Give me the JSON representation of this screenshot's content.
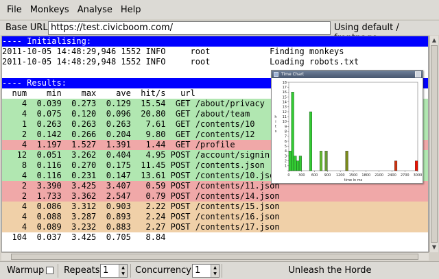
{
  "menu": {
    "items": [
      "File",
      "Monkeys",
      "Analyse",
      "Help"
    ]
  },
  "urlbar": {
    "label": "Base URL",
    "value": "https://test.civicboom.com/",
    "status": "Using default / frontpage"
  },
  "log": {
    "header_init": "---- Initialising:",
    "init_lines": [
      "2011-10-05 14:48:29,946 1552 INFO     root            Finding monkeys",
      "2011-10-05 14:48:29,948 1552 INFO     root            Loading robots.txt"
    ],
    "header_results": "---- Results:",
    "columns_line": "  num    min    max    ave  hit/s   url",
    "rows": [
      {
        "text": "    4  0.039  0.273  0.129  15.54  GET /about/privacy",
        "status": "ok"
      },
      {
        "text": "    4  0.075  0.120  0.096  20.80  GET /about/team",
        "status": "ok"
      },
      {
        "text": "    1  0.263  0.263  0.263   7.61  GET /contents/10",
        "status": "ok"
      },
      {
        "text": "    2  0.142  0.266  0.204   9.80  GET /contents/12",
        "status": "ok"
      },
      {
        "text": "    4  1.197  1.527  1.391   1.44  GET /profile",
        "status": "error"
      },
      {
        "text": "   12  0.051  3.262  0.404   4.95 POST /account/signin.json",
        "status": "ok"
      },
      {
        "text": "    8  0.116  0.270  0.175  11.45 POST /contents.json",
        "status": "ok"
      },
      {
        "text": "    4  0.116  0.231  0.147  13.61 POST /contents/10.json",
        "status": "ok"
      },
      {
        "text": "    2  3.390  3.425  3.407   0.59 POST /contents/11.json",
        "status": "error"
      },
      {
        "text": "    2  1.733  3.362  2.547   0.79 POST /contents/14.json",
        "status": "error"
      },
      {
        "text": "    4  0.086  3.312  0.903   2.22 POST /contents/15.json",
        "status": "warn"
      },
      {
        "text": "    4  0.088  3.287  0.893   2.24 POST /contents/16.json",
        "status": "warn"
      },
      {
        "text": "    4  0.089  3.232  0.883   2.27 POST /contents/17.json",
        "status": "warn"
      }
    ],
    "total_line": "  104  0.037  3.425  0.705   8.84"
  },
  "chart_window": {
    "title": "Time Chart"
  },
  "chart_data": {
    "type": "bar",
    "title": "",
    "xlabel": "time in ms",
    "ylabel": "hits",
    "xlim": [
      0,
      3000
    ],
    "ylim": [
      0,
      18
    ],
    "xticks": [
      0,
      300,
      600,
      900,
      1200,
      1500,
      1800,
      2100,
      2400,
      2700,
      3000
    ],
    "yticks": [
      0,
      1,
      2,
      3,
      4,
      5,
      6,
      7,
      8,
      9,
      10,
      11,
      12,
      13,
      14,
      15,
      16,
      17,
      18
    ],
    "bins": [
      {
        "x": 30,
        "value": 4,
        "color": "#33cc33"
      },
      {
        "x": 90,
        "value": 16,
        "color": "#33cc33"
      },
      {
        "x": 150,
        "value": 3,
        "color": "#33cc33"
      },
      {
        "x": 210,
        "value": 2,
        "color": "#33cc33"
      },
      {
        "x": 270,
        "value": 3,
        "color": "#33cc33"
      },
      {
        "x": 510,
        "value": 12,
        "color": "#33cc33"
      },
      {
        "x": 750,
        "value": 4,
        "color": "#66bb33"
      },
      {
        "x": 870,
        "value": 4,
        "color": "#669933"
      },
      {
        "x": 1350,
        "value": 4,
        "color": "#7a8a1a"
      },
      {
        "x": 2490,
        "value": 2,
        "color": "#cc3311"
      },
      {
        "x": 2970,
        "value": 2,
        "color": "#ee1100"
      }
    ]
  },
  "bottombar": {
    "warmup_label": "Warmup",
    "warmup_checked": false,
    "repeats_label": "Repeats",
    "repeats_value": "1",
    "concurrency_label": "Concurrency",
    "concurrency_value": "1",
    "unleash_label": "Unleash the Horde"
  }
}
